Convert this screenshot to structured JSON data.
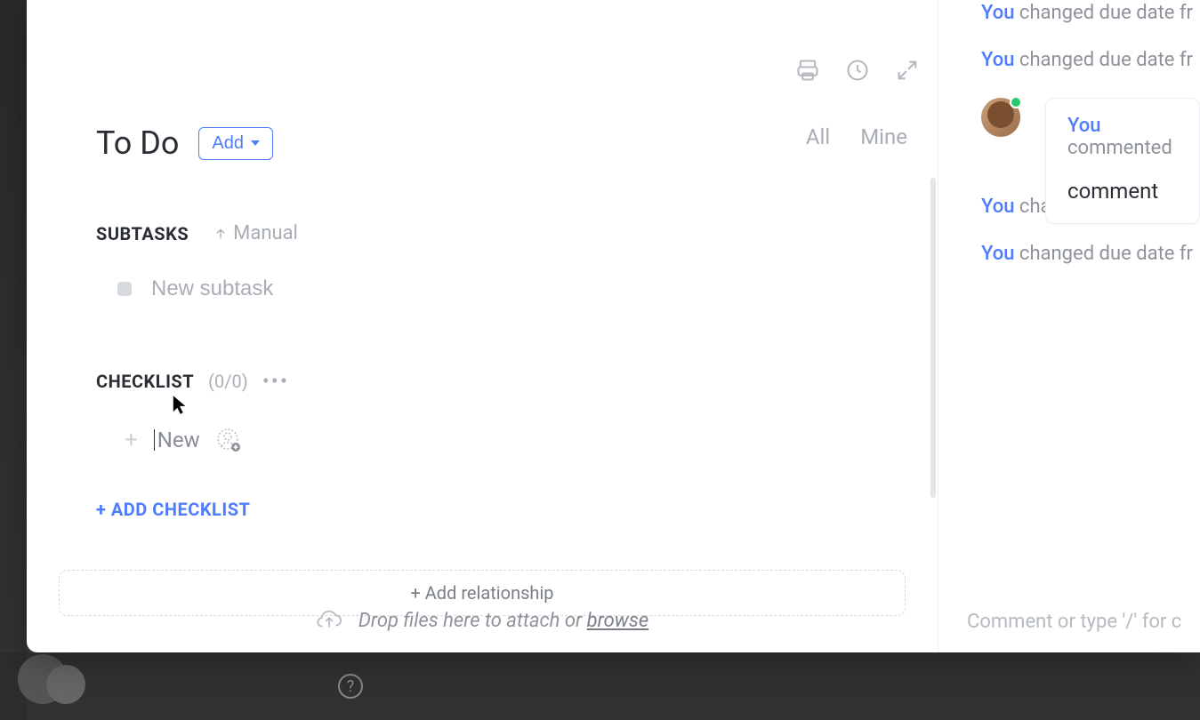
{
  "header": {
    "title": "To Do",
    "add_btn_label": "Add",
    "filter_all": "All",
    "filter_mine": "Mine"
  },
  "subtasks": {
    "label": "SUBTASKS",
    "sort_label": "Manual",
    "new_placeholder": "New subtask"
  },
  "checklist": {
    "label": "CHECKLIST",
    "count": "(0/0)",
    "new_item_text": "New",
    "add_label": "+ ADD CHECKLIST"
  },
  "relationship": {
    "add_label": "+ Add relationship"
  },
  "dropzone": {
    "text": "Drop files here to attach or ",
    "browse_label": "browse"
  },
  "activity": {
    "you_label": "You",
    "line1_suffix": " changed due date fr",
    "line2_suffix": " changed due date fr",
    "line3_suffix": " changed due date fr",
    "line4_suffix": " changed due date fr",
    "comment_header_suffix": " commented",
    "comment_body": "comment",
    "comment_input_placeholder": "Comment or type '/' for c"
  },
  "icons": {
    "print": "print-icon",
    "history": "history-icon",
    "expand": "expand-icon",
    "sort_arrow": "arrow-up-icon",
    "plus": "plus-icon",
    "assignee_add": "assignee-add-icon",
    "upload": "cloud-upload-icon"
  }
}
